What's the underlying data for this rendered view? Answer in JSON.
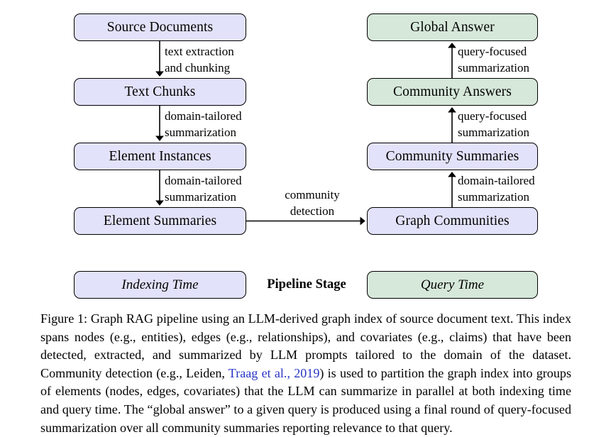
{
  "figure": {
    "colors": {
      "indexing_fill": "#e2e2fa",
      "query_fill": "#d6e8da",
      "border": "#000000",
      "background": "#ffffff",
      "citation_link": "#2a35c4"
    },
    "left_column": {
      "stage": "Indexing Time",
      "nodes": [
        {
          "label": "Source Documents",
          "color": "indexing"
        },
        {
          "label": "Text Chunks",
          "color": "indexing"
        },
        {
          "label": "Element Instances",
          "color": "indexing"
        },
        {
          "label": "Element Summaries",
          "color": "indexing"
        }
      ],
      "edges": [
        {
          "line1": "text extraction",
          "line2": "and chunking"
        },
        {
          "line1": "domain-tailored",
          "line2": "summarization"
        },
        {
          "line1": "domain-tailored",
          "line2": "summarization"
        }
      ]
    },
    "right_column": {
      "stage": "Query Time",
      "nodes": [
        {
          "label": "Global Answer",
          "color": "query"
        },
        {
          "label": "Community Answers",
          "color": "query"
        },
        {
          "label": "Community Summaries",
          "color": "indexing"
        },
        {
          "label": "Graph Communities",
          "color": "indexing"
        }
      ],
      "edges": [
        {
          "line1": "query-focused",
          "line2": "summarization"
        },
        {
          "line1": "query-focused",
          "line2": "summarization"
        },
        {
          "line1": "domain-tailored",
          "line2": "summarization"
        }
      ]
    },
    "cross_edge": {
      "line1": "community",
      "line2": "detection"
    },
    "legend": {
      "left_label": "Indexing Time",
      "center_label": "Pipeline Stage",
      "right_label": "Query Time"
    }
  },
  "caption": {
    "part1": "Figure 1: Graph RAG pipeline using an LLM-derived graph index of source document text. This index spans nodes (e.g., entities), edges (e.g., relationships), and covariates (e.g., claims) that have been detected, extracted, and summarized by LLM prompts tailored to the domain of the dataset. Community detection (e.g., Leiden, ",
    "citation": "Traag et al., 2019",
    "part2": ") is used to partition the graph index into groups of elements (nodes, edges, covariates) that the LLM can summarize in parallel at both indexing time and query time. The “global answer” to a given query is produced using a final round of query-focused summarization over all community summaries reporting relevance to that query."
  }
}
